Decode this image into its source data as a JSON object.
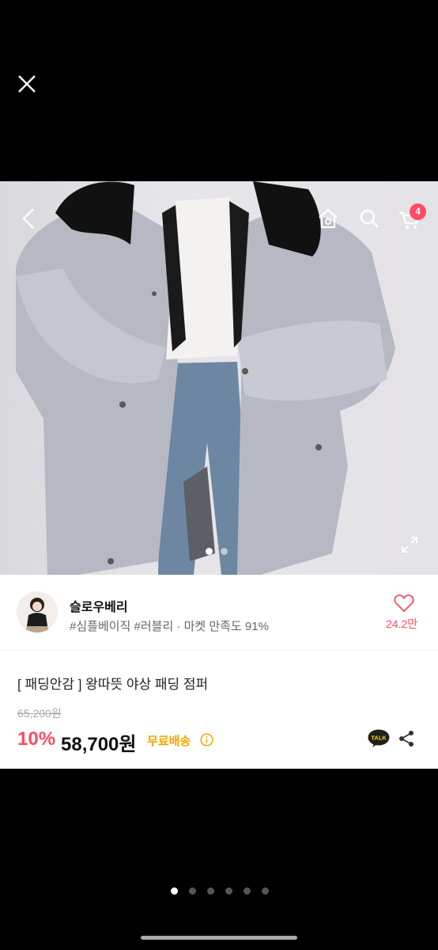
{
  "shop": {
    "name": "슬로우베리",
    "tags": "#심플베이직 #러블리 · 마켓 만족도 91%",
    "likes": "24.2만"
  },
  "product": {
    "title": "[ 패딩안감 ] 왕따뜻 야상 패딩 점퍼",
    "original_price": "65,200원",
    "discount": "10%",
    "price": "58,700원",
    "shipping": "무료배송"
  },
  "cart": {
    "count": "4"
  },
  "talk_label": "TALK",
  "icons": [
    "close-icon",
    "back-icon",
    "home-icon",
    "search-icon",
    "cart-icon",
    "expand-icon",
    "heart-icon",
    "info-icon",
    "kakao-talk-icon",
    "share-icon"
  ],
  "colors": {
    "accent": "#ff4c62",
    "shipping": "#f0a500"
  }
}
